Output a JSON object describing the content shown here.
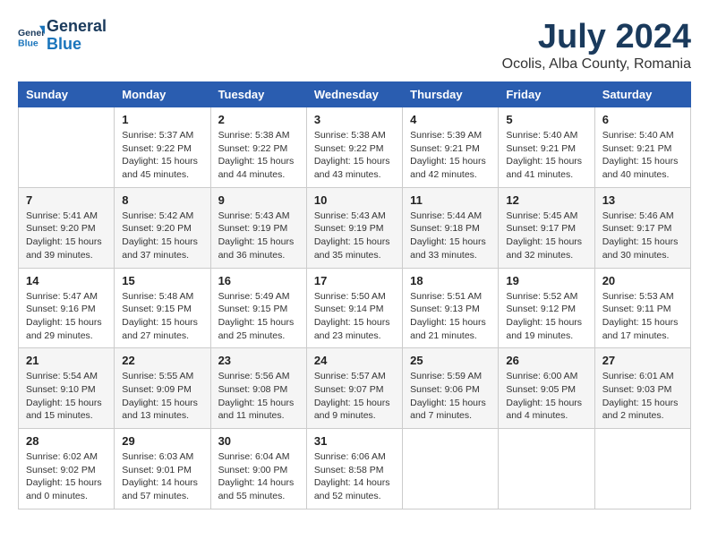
{
  "header": {
    "logo_line1": "General",
    "logo_line2": "Blue",
    "month_title": "July 2024",
    "location": "Ocolis, Alba County, Romania"
  },
  "weekdays": [
    "Sunday",
    "Monday",
    "Tuesday",
    "Wednesday",
    "Thursday",
    "Friday",
    "Saturday"
  ],
  "weeks": [
    [
      {
        "day": "",
        "info": ""
      },
      {
        "day": "1",
        "info": "Sunrise: 5:37 AM\nSunset: 9:22 PM\nDaylight: 15 hours\nand 45 minutes."
      },
      {
        "day": "2",
        "info": "Sunrise: 5:38 AM\nSunset: 9:22 PM\nDaylight: 15 hours\nand 44 minutes."
      },
      {
        "day": "3",
        "info": "Sunrise: 5:38 AM\nSunset: 9:22 PM\nDaylight: 15 hours\nand 43 minutes."
      },
      {
        "day": "4",
        "info": "Sunrise: 5:39 AM\nSunset: 9:21 PM\nDaylight: 15 hours\nand 42 minutes."
      },
      {
        "day": "5",
        "info": "Sunrise: 5:40 AM\nSunset: 9:21 PM\nDaylight: 15 hours\nand 41 minutes."
      },
      {
        "day": "6",
        "info": "Sunrise: 5:40 AM\nSunset: 9:21 PM\nDaylight: 15 hours\nand 40 minutes."
      }
    ],
    [
      {
        "day": "7",
        "info": "Sunrise: 5:41 AM\nSunset: 9:20 PM\nDaylight: 15 hours\nand 39 minutes."
      },
      {
        "day": "8",
        "info": "Sunrise: 5:42 AM\nSunset: 9:20 PM\nDaylight: 15 hours\nand 37 minutes."
      },
      {
        "day": "9",
        "info": "Sunrise: 5:43 AM\nSunset: 9:19 PM\nDaylight: 15 hours\nand 36 minutes."
      },
      {
        "day": "10",
        "info": "Sunrise: 5:43 AM\nSunset: 9:19 PM\nDaylight: 15 hours\nand 35 minutes."
      },
      {
        "day": "11",
        "info": "Sunrise: 5:44 AM\nSunset: 9:18 PM\nDaylight: 15 hours\nand 33 minutes."
      },
      {
        "day": "12",
        "info": "Sunrise: 5:45 AM\nSunset: 9:17 PM\nDaylight: 15 hours\nand 32 minutes."
      },
      {
        "day": "13",
        "info": "Sunrise: 5:46 AM\nSunset: 9:17 PM\nDaylight: 15 hours\nand 30 minutes."
      }
    ],
    [
      {
        "day": "14",
        "info": "Sunrise: 5:47 AM\nSunset: 9:16 PM\nDaylight: 15 hours\nand 29 minutes."
      },
      {
        "day": "15",
        "info": "Sunrise: 5:48 AM\nSunset: 9:15 PM\nDaylight: 15 hours\nand 27 minutes."
      },
      {
        "day": "16",
        "info": "Sunrise: 5:49 AM\nSunset: 9:15 PM\nDaylight: 15 hours\nand 25 minutes."
      },
      {
        "day": "17",
        "info": "Sunrise: 5:50 AM\nSunset: 9:14 PM\nDaylight: 15 hours\nand 23 minutes."
      },
      {
        "day": "18",
        "info": "Sunrise: 5:51 AM\nSunset: 9:13 PM\nDaylight: 15 hours\nand 21 minutes."
      },
      {
        "day": "19",
        "info": "Sunrise: 5:52 AM\nSunset: 9:12 PM\nDaylight: 15 hours\nand 19 minutes."
      },
      {
        "day": "20",
        "info": "Sunrise: 5:53 AM\nSunset: 9:11 PM\nDaylight: 15 hours\nand 17 minutes."
      }
    ],
    [
      {
        "day": "21",
        "info": "Sunrise: 5:54 AM\nSunset: 9:10 PM\nDaylight: 15 hours\nand 15 minutes."
      },
      {
        "day": "22",
        "info": "Sunrise: 5:55 AM\nSunset: 9:09 PM\nDaylight: 15 hours\nand 13 minutes."
      },
      {
        "day": "23",
        "info": "Sunrise: 5:56 AM\nSunset: 9:08 PM\nDaylight: 15 hours\nand 11 minutes."
      },
      {
        "day": "24",
        "info": "Sunrise: 5:57 AM\nSunset: 9:07 PM\nDaylight: 15 hours\nand 9 minutes."
      },
      {
        "day": "25",
        "info": "Sunrise: 5:59 AM\nSunset: 9:06 PM\nDaylight: 15 hours\nand 7 minutes."
      },
      {
        "day": "26",
        "info": "Sunrise: 6:00 AM\nSunset: 9:05 PM\nDaylight: 15 hours\nand 4 minutes."
      },
      {
        "day": "27",
        "info": "Sunrise: 6:01 AM\nSunset: 9:03 PM\nDaylight: 15 hours\nand 2 minutes."
      }
    ],
    [
      {
        "day": "28",
        "info": "Sunrise: 6:02 AM\nSunset: 9:02 PM\nDaylight: 15 hours\nand 0 minutes."
      },
      {
        "day": "29",
        "info": "Sunrise: 6:03 AM\nSunset: 9:01 PM\nDaylight: 14 hours\nand 57 minutes."
      },
      {
        "day": "30",
        "info": "Sunrise: 6:04 AM\nSunset: 9:00 PM\nDaylight: 14 hours\nand 55 minutes."
      },
      {
        "day": "31",
        "info": "Sunrise: 6:06 AM\nSunset: 8:58 PM\nDaylight: 14 hours\nand 52 minutes."
      },
      {
        "day": "",
        "info": ""
      },
      {
        "day": "",
        "info": ""
      },
      {
        "day": "",
        "info": ""
      }
    ]
  ]
}
